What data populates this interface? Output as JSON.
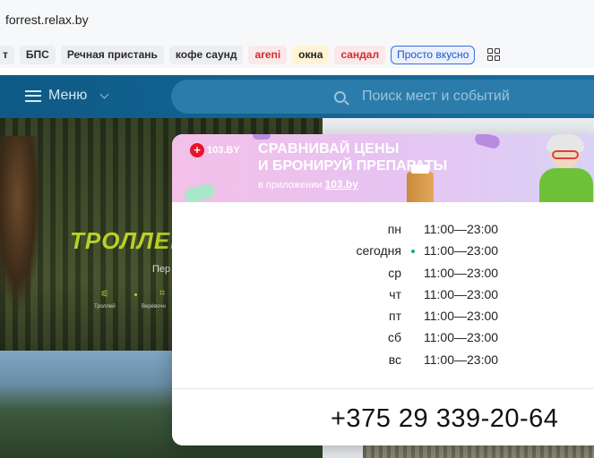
{
  "browser": {
    "url": "forrest.relax.by",
    "bookmarks": [
      {
        "label": "т",
        "style": "first"
      },
      {
        "label": "БПС",
        "style": ""
      },
      {
        "label": "Речная пристань",
        "style": ""
      },
      {
        "label": "кофе саунд",
        "style": ""
      },
      {
        "label": "areni",
        "style": "red"
      },
      {
        "label": "окна",
        "style": "yellow"
      },
      {
        "label": "сандал",
        "style": "red"
      },
      {
        "label": "Просто вкусно",
        "style": "outline"
      }
    ],
    "apps_icon": "grid-icon"
  },
  "site": {
    "menu_label": "Меню",
    "search_placeholder": "Поиск мест и событий",
    "hero_title": "ТРОЛЛЕЙ",
    "hero_subtitle": "Пер",
    "hero_labels": [
      "Троллей",
      "Верёвочн"
    ]
  },
  "ad": {
    "brand": "103.BY",
    "headline_1": "СРАВНИВАЙ ЦЕНЫ",
    "headline_2": "И БРОНИРУЙ ПРЕПАРАТЫ",
    "sub_prefix": "в приложении ",
    "sub_link": "103.by"
  },
  "schedule": [
    {
      "day": "пн",
      "time": "11:00—23:00",
      "today": false
    },
    {
      "day": "сегодня",
      "time": "11:00—23:00",
      "today": true
    },
    {
      "day": "ср",
      "time": "11:00—23:00",
      "today": false
    },
    {
      "day": "чт",
      "time": "11:00—23:00",
      "today": false
    },
    {
      "day": "пт",
      "time": "11:00—23:00",
      "today": false
    },
    {
      "day": "сб",
      "time": "11:00—23:00",
      "today": false
    },
    {
      "day": "вс",
      "time": "11:00—23:00",
      "today": false
    }
  ],
  "phone": "+375 29 339-20-64",
  "colors": {
    "site_header": "#0e5a86",
    "today_dot": "#1aa58c",
    "hero_accent": "#b8d02a"
  }
}
